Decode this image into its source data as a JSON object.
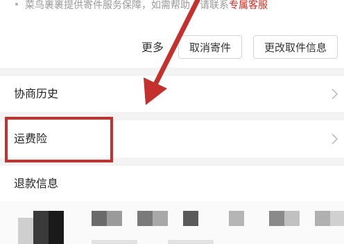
{
  "notice": {
    "text": "菜鸟裹裹提供寄件服务保障，如需帮助，请联系",
    "link": "专属客服"
  },
  "actions": {
    "more": "更多",
    "cancel": "取消寄件",
    "change": "更改取件信息"
  },
  "rows": [
    {
      "label": "协商历史"
    },
    {
      "label": "运费险"
    },
    {
      "label": "退款信息"
    }
  ],
  "colors": {
    "accent": "#e0281e",
    "annotation": "#c4302b"
  },
  "icons": {
    "chevron": "chevron-right-icon",
    "arrow": "annotation-arrow-icon"
  }
}
